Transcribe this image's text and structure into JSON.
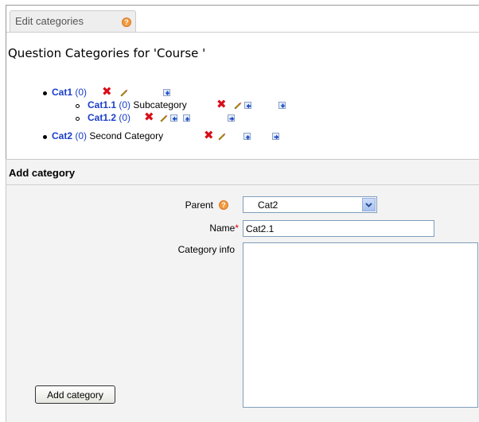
{
  "tab": {
    "label": "Edit categories",
    "help": "?"
  },
  "heading": "Question Categories for 'Course '",
  "tree": {
    "cat1": {
      "name": "Cat1",
      "count": "(0)",
      "info": ""
    },
    "cat1_1": {
      "name": "Cat1.1",
      "count": "(0)",
      "info": "Subcategory"
    },
    "cat1_2": {
      "name": "Cat1.2",
      "count": "(0)",
      "info": ""
    },
    "cat2": {
      "name": "Cat2",
      "count": "(0)",
      "info": "Second Category"
    }
  },
  "form": {
    "legend": "Add category",
    "parent_label": "Parent",
    "parent_value": "Cat2",
    "name_label": "Name",
    "name_required": "*",
    "name_value": "Cat2.1",
    "info_label": "Category info",
    "submit_label": "Add category"
  },
  "colors": {
    "link": "#1a3ec9",
    "delete": "#d80e1a",
    "help": "#f39a3c"
  }
}
